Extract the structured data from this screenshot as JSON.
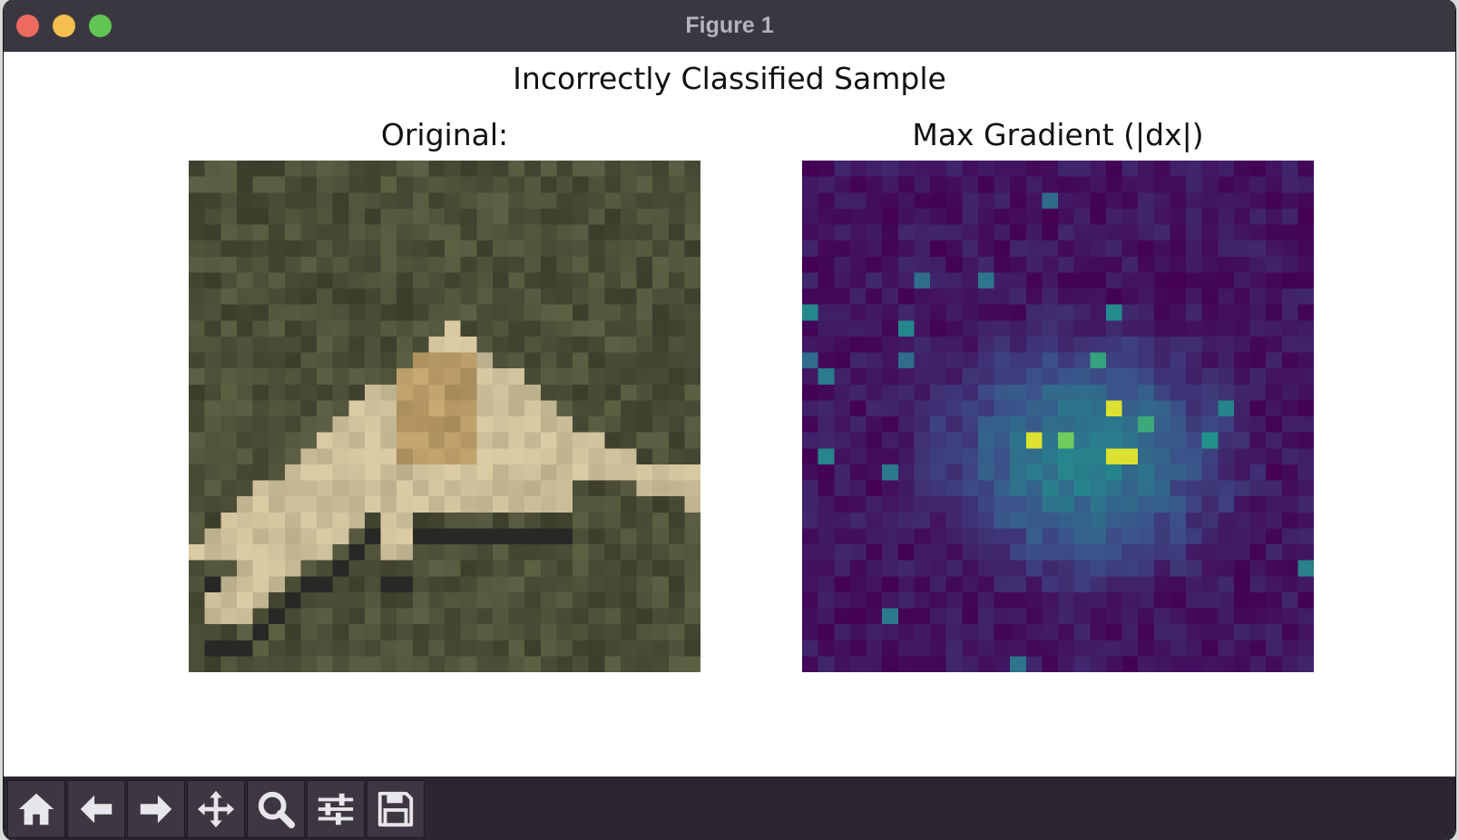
{
  "window": {
    "title": "Figure 1"
  },
  "figure": {
    "suptitle": "Incorrectly Classified Sample",
    "panels": [
      {
        "title": "Original:",
        "image": "32x32 low-resolution photo of a white airplane against green-brown grass"
      },
      {
        "title": "Max Gradient (|dx|)",
        "image": "32x32 saliency heatmap",
        "colormap": "viridis"
      }
    ]
  },
  "toolbar": {
    "buttons": [
      {
        "name": "home-icon"
      },
      {
        "name": "back-arrow-icon"
      },
      {
        "name": "forward-arrow-icon"
      },
      {
        "name": "pan-icon"
      },
      {
        "name": "zoom-icon"
      },
      {
        "name": "configure-subplots-icon"
      },
      {
        "name": "save-icon"
      }
    ]
  },
  "colors": {
    "titlebar": "#3a3740",
    "toolbar": "#2b2631",
    "close": "#ed6a5e",
    "minimize": "#f4bf4f",
    "maximize": "#61c554"
  }
}
